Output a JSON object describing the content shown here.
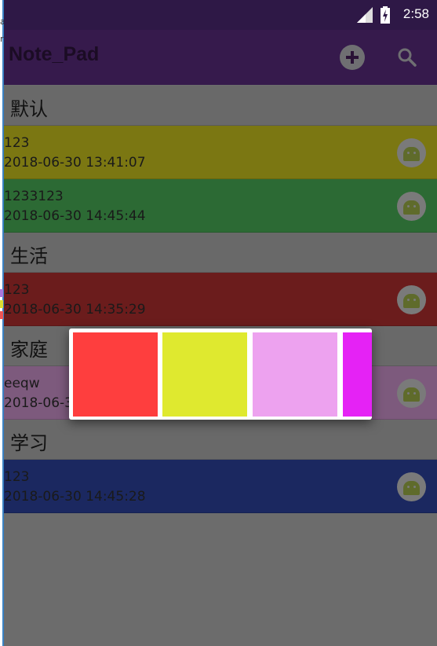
{
  "left_edge": {
    "fragments": [
      "a",
      "r"
    ]
  },
  "status_bar": {
    "time": "2:58",
    "icons": [
      "signal-icon",
      "battery-charging-icon"
    ]
  },
  "app_bar": {
    "title": "Note_Pad",
    "actions": [
      "add-icon",
      "search-icon"
    ]
  },
  "groups": [
    {
      "header": "默认",
      "notes": [
        {
          "title": "123",
          "time": "2018-06-30 13:41:07",
          "color": "#7b7712"
        },
        {
          "title": "1233123",
          "time": "2018-06-30 14:45:44",
          "color": "#2c6a34"
        }
      ]
    },
    {
      "header": "生活",
      "notes": [
        {
          "title": "123",
          "time": "2018-06-30 14:35:29",
          "color": "#6b1c1c"
        }
      ]
    },
    {
      "header": "家庭",
      "notes": [
        {
          "title": "eeqw",
          "time": "2018-06-3",
          "color": "#7d5a7d"
        }
      ]
    },
    {
      "header": "学习",
      "notes": [
        {
          "title": "123",
          "time": "2018-06-30 14:45:28",
          "color": "#1b2860"
        }
      ]
    }
  ],
  "color_picker": {
    "colors": [
      "#fe3e3e",
      "#dfe92f",
      "#eda2ef",
      "#e522f5"
    ]
  }
}
